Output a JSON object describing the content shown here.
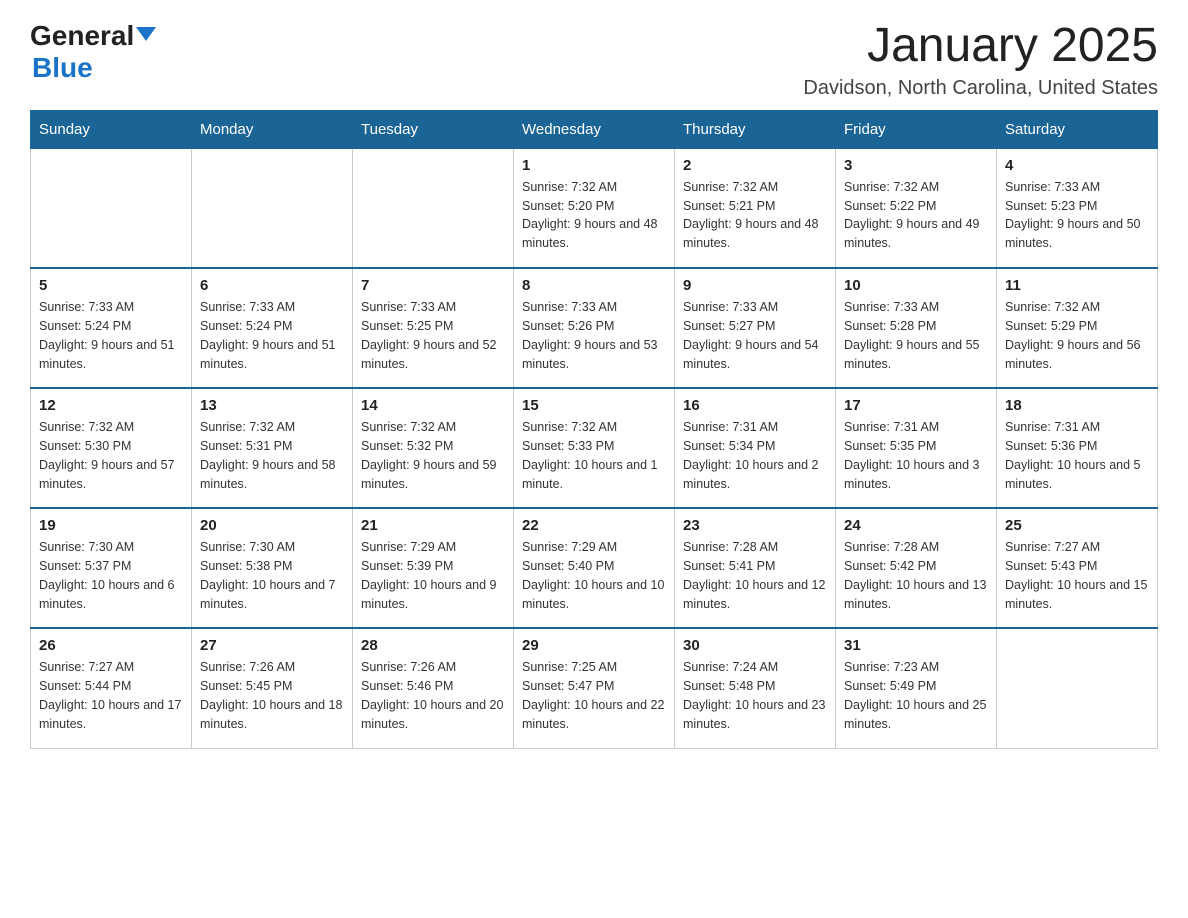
{
  "header": {
    "logo": {
      "text1": "General",
      "text2": "Blue"
    },
    "title": "January 2025",
    "location": "Davidson, North Carolina, United States"
  },
  "calendar": {
    "days_of_week": [
      "Sunday",
      "Monday",
      "Tuesday",
      "Wednesday",
      "Thursday",
      "Friday",
      "Saturday"
    ],
    "weeks": [
      [
        {
          "day": "",
          "info": ""
        },
        {
          "day": "",
          "info": ""
        },
        {
          "day": "",
          "info": ""
        },
        {
          "day": "1",
          "info": "Sunrise: 7:32 AM\nSunset: 5:20 PM\nDaylight: 9 hours and 48 minutes."
        },
        {
          "day": "2",
          "info": "Sunrise: 7:32 AM\nSunset: 5:21 PM\nDaylight: 9 hours and 48 minutes."
        },
        {
          "day": "3",
          "info": "Sunrise: 7:32 AM\nSunset: 5:22 PM\nDaylight: 9 hours and 49 minutes."
        },
        {
          "day": "4",
          "info": "Sunrise: 7:33 AM\nSunset: 5:23 PM\nDaylight: 9 hours and 50 minutes."
        }
      ],
      [
        {
          "day": "5",
          "info": "Sunrise: 7:33 AM\nSunset: 5:24 PM\nDaylight: 9 hours and 51 minutes."
        },
        {
          "day": "6",
          "info": "Sunrise: 7:33 AM\nSunset: 5:24 PM\nDaylight: 9 hours and 51 minutes."
        },
        {
          "day": "7",
          "info": "Sunrise: 7:33 AM\nSunset: 5:25 PM\nDaylight: 9 hours and 52 minutes."
        },
        {
          "day": "8",
          "info": "Sunrise: 7:33 AM\nSunset: 5:26 PM\nDaylight: 9 hours and 53 minutes."
        },
        {
          "day": "9",
          "info": "Sunrise: 7:33 AM\nSunset: 5:27 PM\nDaylight: 9 hours and 54 minutes."
        },
        {
          "day": "10",
          "info": "Sunrise: 7:33 AM\nSunset: 5:28 PM\nDaylight: 9 hours and 55 minutes."
        },
        {
          "day": "11",
          "info": "Sunrise: 7:32 AM\nSunset: 5:29 PM\nDaylight: 9 hours and 56 minutes."
        }
      ],
      [
        {
          "day": "12",
          "info": "Sunrise: 7:32 AM\nSunset: 5:30 PM\nDaylight: 9 hours and 57 minutes."
        },
        {
          "day": "13",
          "info": "Sunrise: 7:32 AM\nSunset: 5:31 PM\nDaylight: 9 hours and 58 minutes."
        },
        {
          "day": "14",
          "info": "Sunrise: 7:32 AM\nSunset: 5:32 PM\nDaylight: 9 hours and 59 minutes."
        },
        {
          "day": "15",
          "info": "Sunrise: 7:32 AM\nSunset: 5:33 PM\nDaylight: 10 hours and 1 minute."
        },
        {
          "day": "16",
          "info": "Sunrise: 7:31 AM\nSunset: 5:34 PM\nDaylight: 10 hours and 2 minutes."
        },
        {
          "day": "17",
          "info": "Sunrise: 7:31 AM\nSunset: 5:35 PM\nDaylight: 10 hours and 3 minutes."
        },
        {
          "day": "18",
          "info": "Sunrise: 7:31 AM\nSunset: 5:36 PM\nDaylight: 10 hours and 5 minutes."
        }
      ],
      [
        {
          "day": "19",
          "info": "Sunrise: 7:30 AM\nSunset: 5:37 PM\nDaylight: 10 hours and 6 minutes."
        },
        {
          "day": "20",
          "info": "Sunrise: 7:30 AM\nSunset: 5:38 PM\nDaylight: 10 hours and 7 minutes."
        },
        {
          "day": "21",
          "info": "Sunrise: 7:29 AM\nSunset: 5:39 PM\nDaylight: 10 hours and 9 minutes."
        },
        {
          "day": "22",
          "info": "Sunrise: 7:29 AM\nSunset: 5:40 PM\nDaylight: 10 hours and 10 minutes."
        },
        {
          "day": "23",
          "info": "Sunrise: 7:28 AM\nSunset: 5:41 PM\nDaylight: 10 hours and 12 minutes."
        },
        {
          "day": "24",
          "info": "Sunrise: 7:28 AM\nSunset: 5:42 PM\nDaylight: 10 hours and 13 minutes."
        },
        {
          "day": "25",
          "info": "Sunrise: 7:27 AM\nSunset: 5:43 PM\nDaylight: 10 hours and 15 minutes."
        }
      ],
      [
        {
          "day": "26",
          "info": "Sunrise: 7:27 AM\nSunset: 5:44 PM\nDaylight: 10 hours and 17 minutes."
        },
        {
          "day": "27",
          "info": "Sunrise: 7:26 AM\nSunset: 5:45 PM\nDaylight: 10 hours and 18 minutes."
        },
        {
          "day": "28",
          "info": "Sunrise: 7:26 AM\nSunset: 5:46 PM\nDaylight: 10 hours and 20 minutes."
        },
        {
          "day": "29",
          "info": "Sunrise: 7:25 AM\nSunset: 5:47 PM\nDaylight: 10 hours and 22 minutes."
        },
        {
          "day": "30",
          "info": "Sunrise: 7:24 AM\nSunset: 5:48 PM\nDaylight: 10 hours and 23 minutes."
        },
        {
          "day": "31",
          "info": "Sunrise: 7:23 AM\nSunset: 5:49 PM\nDaylight: 10 hours and 25 minutes."
        },
        {
          "day": "",
          "info": ""
        }
      ]
    ]
  }
}
